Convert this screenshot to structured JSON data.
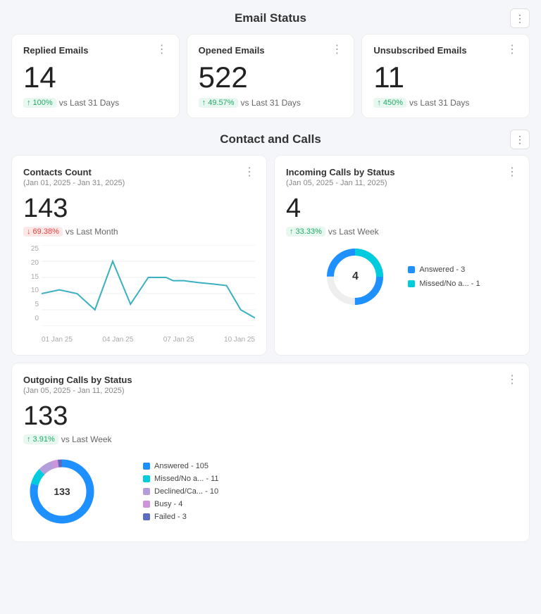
{
  "email_status": {
    "section_title": "Email Status",
    "menu_icon": "⋮",
    "cards": [
      {
        "title": "Replied Emails",
        "value": "14",
        "badge": "↑ 100%",
        "badge_type": "up",
        "comparison": "vs Last 31 Days"
      },
      {
        "title": "Opened Emails",
        "value": "522",
        "badge": "↑ 49.57%",
        "badge_type": "up",
        "comparison": "vs Last 31 Days"
      },
      {
        "title": "Unsubscribed Emails",
        "value": "11",
        "badge": "↑ 450%",
        "badge_type": "up",
        "comparison": "vs Last 31 Days"
      }
    ]
  },
  "contact_calls": {
    "section_title": "Contact and Calls",
    "contacts_count": {
      "title": "Contacts Count",
      "subtitle": "(Jan 01, 2025 - Jan 31, 2025)",
      "value": "143",
      "badge": "↓ 69.38%",
      "badge_type": "down",
      "comparison": "vs Last Month",
      "chart_y_labels": [
        "25",
        "20",
        "15",
        "10",
        "5",
        "0"
      ],
      "chart_x_labels": [
        "01 Jan 25",
        "04 Jan 25",
        "07 Jan 25",
        "10 Jan 25"
      ]
    },
    "incoming_calls": {
      "title": "Incoming Calls by Status",
      "subtitle": "(Jan 05, 2025 - Jan 11, 2025)",
      "value": "4",
      "badge": "↑ 33.33%",
      "badge_type": "up",
      "comparison": "vs Last Week",
      "donut_center": "4",
      "legend": [
        {
          "label": "Answered - 3",
          "color": "#1e90ff"
        },
        {
          "label": "Missed/No a... - 1",
          "color": "#00ccdd"
        }
      ],
      "donut_segments": [
        {
          "value": 3,
          "color": "#1e90ff"
        },
        {
          "value": 1,
          "color": "#00ccdd"
        }
      ]
    },
    "outgoing_calls": {
      "title": "Outgoing Calls by Status",
      "subtitle": "(Jan 05, 2025 - Jan 11, 2025)",
      "value": "133",
      "badge": "↑ 3.91%",
      "badge_type": "up",
      "comparison": "vs Last Week",
      "donut_center": "133",
      "legend": [
        {
          "label": "Answered - 105",
          "color": "#1e90ff"
        },
        {
          "label": "Missed/No a... - 11",
          "color": "#00ccdd"
        },
        {
          "label": "Declined/Ca... - 10",
          "color": "#b39ddb"
        },
        {
          "label": "Busy - 4",
          "color": "#ce93d8"
        },
        {
          "label": "Failed - 3",
          "color": "#5c6bc0"
        }
      ],
      "donut_segments": [
        {
          "value": 105,
          "color": "#1e90ff"
        },
        {
          "value": 11,
          "color": "#00ccdd"
        },
        {
          "value": 10,
          "color": "#b39ddb"
        },
        {
          "value": 4,
          "color": "#ce93d8"
        },
        {
          "value": 3,
          "color": "#5c6bc0"
        }
      ]
    }
  }
}
